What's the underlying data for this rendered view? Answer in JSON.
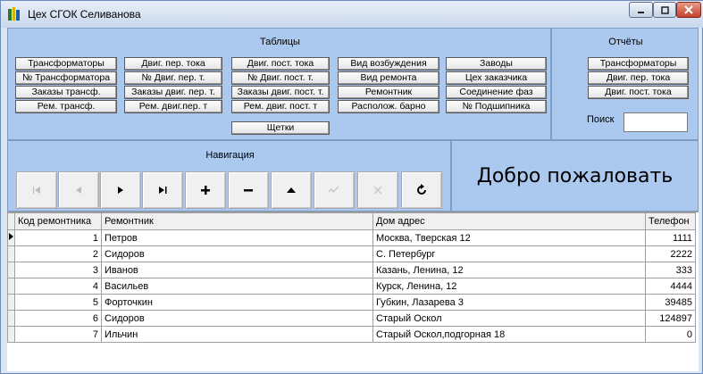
{
  "window": {
    "title": "Цех СГОК Селиванова"
  },
  "tables_panel": {
    "title": "Таблицы",
    "buttons": [
      "Трансформаторы",
      "Двиг. пер. тока",
      "Двиг. пост. тока",
      "Вид возбуждения",
      "Заводы",
      "№ Трансформатора",
      "№ Двиг. пер. т.",
      "№ Двиг. пост. т.",
      "Вид ремонта",
      "Цех заказчика",
      "Заказы трансф.",
      "Заказы двиг. пер. т.",
      "Заказы двиг. пост. т.",
      "Ремонтник",
      "Соединение фаз",
      "Рем. трансф.",
      "Рем. двиг.пер. т",
      "Рем. двиг. пост. т",
      "Располож. барно",
      "№ Подшипника",
      "Щетки"
    ]
  },
  "reports_panel": {
    "title": "Отчёты",
    "buttons": [
      "Трансформаторы",
      "Двиг. пер. тока",
      "Двиг. пост. тока"
    ],
    "search_label": "Поиск",
    "search_value": ""
  },
  "navigation": {
    "title": "Навигация",
    "buttons": [
      {
        "name": "first",
        "icon": "first-record-icon",
        "enabled": false
      },
      {
        "name": "prior",
        "icon": "prior-record-icon",
        "enabled": false
      },
      {
        "name": "next",
        "icon": "next-record-icon",
        "enabled": true
      },
      {
        "name": "last",
        "icon": "last-record-icon",
        "enabled": true
      },
      {
        "name": "insert",
        "icon": "plus-icon",
        "enabled": true
      },
      {
        "name": "delete",
        "icon": "minus-icon",
        "enabled": true
      },
      {
        "name": "edit",
        "icon": "edit-triangle-icon",
        "enabled": true
      },
      {
        "name": "post",
        "icon": "check-icon",
        "enabled": false
      },
      {
        "name": "cancel",
        "icon": "cancel-x-icon",
        "enabled": false
      },
      {
        "name": "refresh",
        "icon": "refresh-icon",
        "enabled": true
      }
    ]
  },
  "welcome_text": "Добро пожаловать",
  "grid": {
    "columns": [
      "Код ремонтника",
      "Ремонтник",
      "Дом адрес",
      "Телефон"
    ],
    "rows": [
      [
        "1",
        "Петров",
        "Москва, Тверская 12",
        "1111"
      ],
      [
        "2",
        "Сидоров",
        "С. Петербург",
        "2222"
      ],
      [
        "3",
        "Иванов",
        "Казань, Ленина, 12",
        "333"
      ],
      [
        "4",
        "Васильев",
        "Курск, Ленина, 12",
        "4444"
      ],
      [
        "5",
        "Форточкин",
        "Губкин, Лазарева 3",
        "39485"
      ],
      [
        "6",
        "Сидоров",
        "Старый Оскол",
        "124897"
      ],
      [
        "7",
        "Ильчин",
        "Старый Оскол,подгорная 18",
        "0"
      ]
    ],
    "current_row": 0
  },
  "colors": {
    "panel": "#abc9ef",
    "title_bar": "#c9d8ec",
    "close_button": "#c5412a"
  }
}
